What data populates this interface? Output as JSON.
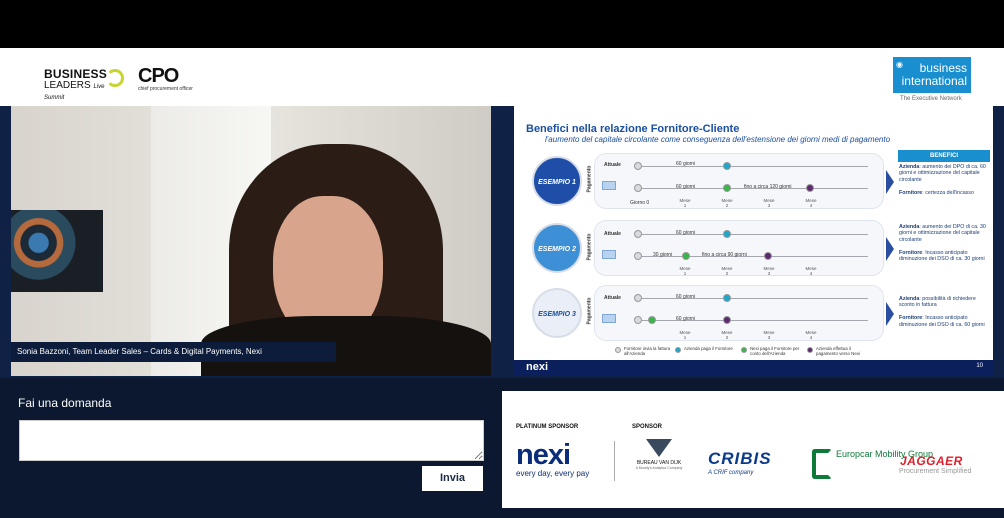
{
  "header": {
    "bl_logo_line1": "BUSINESS",
    "bl_logo_line2": "LEADERS",
    "bl_logo_line2_tag": "Live Summit",
    "cpo_logo": "CPO",
    "cpo_sub": "chief procurement officer",
    "bi_logo": "business international",
    "bi_tagline": "The Executive Network"
  },
  "video": {
    "caption": "Sonia Bazzoni, Team Leader Sales – Cards & Digital Payments, Nexi"
  },
  "slide": {
    "title": "Benefici nella relazione Fornitore-Cliente",
    "subtitle": "l'aumento del capitale circolante come conseguenza dell'estensione dei giorni medi di pagamento",
    "benefits_header": "BENEFICI",
    "pagamento": "Pagamento",
    "attuale": "Attuale",
    "giorno0": "Giorno 0",
    "mese_word": "Mese",
    "footer_logo": "nexi",
    "page_number": "10",
    "examples": [
      {
        "label": "ESEMPIO 1",
        "row1_days": "60 giorni",
        "row2_days": "60 giorni",
        "row2_ext": "fino a circa 120 giorni",
        "ben_azienda_label": "Azienda",
        "ben_azienda": ": aumento dei DPO di ca. 60 giorni e ottimizzazione del capitale circolante",
        "ben_fornitore_label": "Fornitore",
        "ben_fornitore": ": certezza dell'incasso"
      },
      {
        "label": "ESEMPIO 2",
        "row1_days": "60 giorni",
        "row2_days": "30 giorni",
        "row2_ext": "fino a circa 90 giorni",
        "ben_azienda_label": "Azienda",
        "ben_azienda": ": aumento dei DPO di ca. 30 giorni e ottimizzazione del capitale circolante",
        "ben_fornitore_label": "Fornitore",
        "ben_fornitore": ": Incasso anticipato diminuzione dei DSO di ca. 30 giorni"
      },
      {
        "label": "ESEMPIO 3",
        "row1_days": "60 giorni",
        "row2_days": "60 giorni",
        "row2_ext": "",
        "ben_azienda_label": "Azienda",
        "ben_azienda": ": possibilità di richiedere sconto in fattura",
        "ben_fornitore_label": "Fornitore",
        "ben_fornitore": ": Incasso anticipato diminuzione dei DSO di ca. 60 giorni"
      }
    ],
    "legend": [
      {
        "text": "Fornitore invia la fattura all'Azienda",
        "color": "#d9dadd"
      },
      {
        "text": "Azienda paga il Fornitore",
        "color": "#1ea7c9"
      },
      {
        "text": "Nexi paga il Fornitore per conto dell'Azienda",
        "color": "#3bb44a"
      },
      {
        "text": "Azienda effettua il pagamento verso Nexi",
        "color": "#5c2a6e"
      }
    ]
  },
  "qa": {
    "label": "Fai una domanda",
    "input_placeholder": "",
    "send_button": "Invia"
  },
  "sponsors": {
    "platinum_label": "PLATINUM SPONSOR",
    "sponsor_label": "SPONSOR",
    "nexi": "nexi",
    "nexi_tag": "every day, every pay",
    "bvd": "BUREAU VAN DIJK",
    "bvd_sub": "A Moody's Analytics Company",
    "cribis": "CRIBIS",
    "cribis_sub": "A CRIF company",
    "europcar": "Europcar Mobility Group",
    "jaggaer": "JAGGAER",
    "jaggaer_sub": "Procurement Simplified"
  },
  "colors": {
    "accent_blue": "#1b4fa0",
    "nexi_navy": "#0a2c7a",
    "background": "#0b1830"
  }
}
